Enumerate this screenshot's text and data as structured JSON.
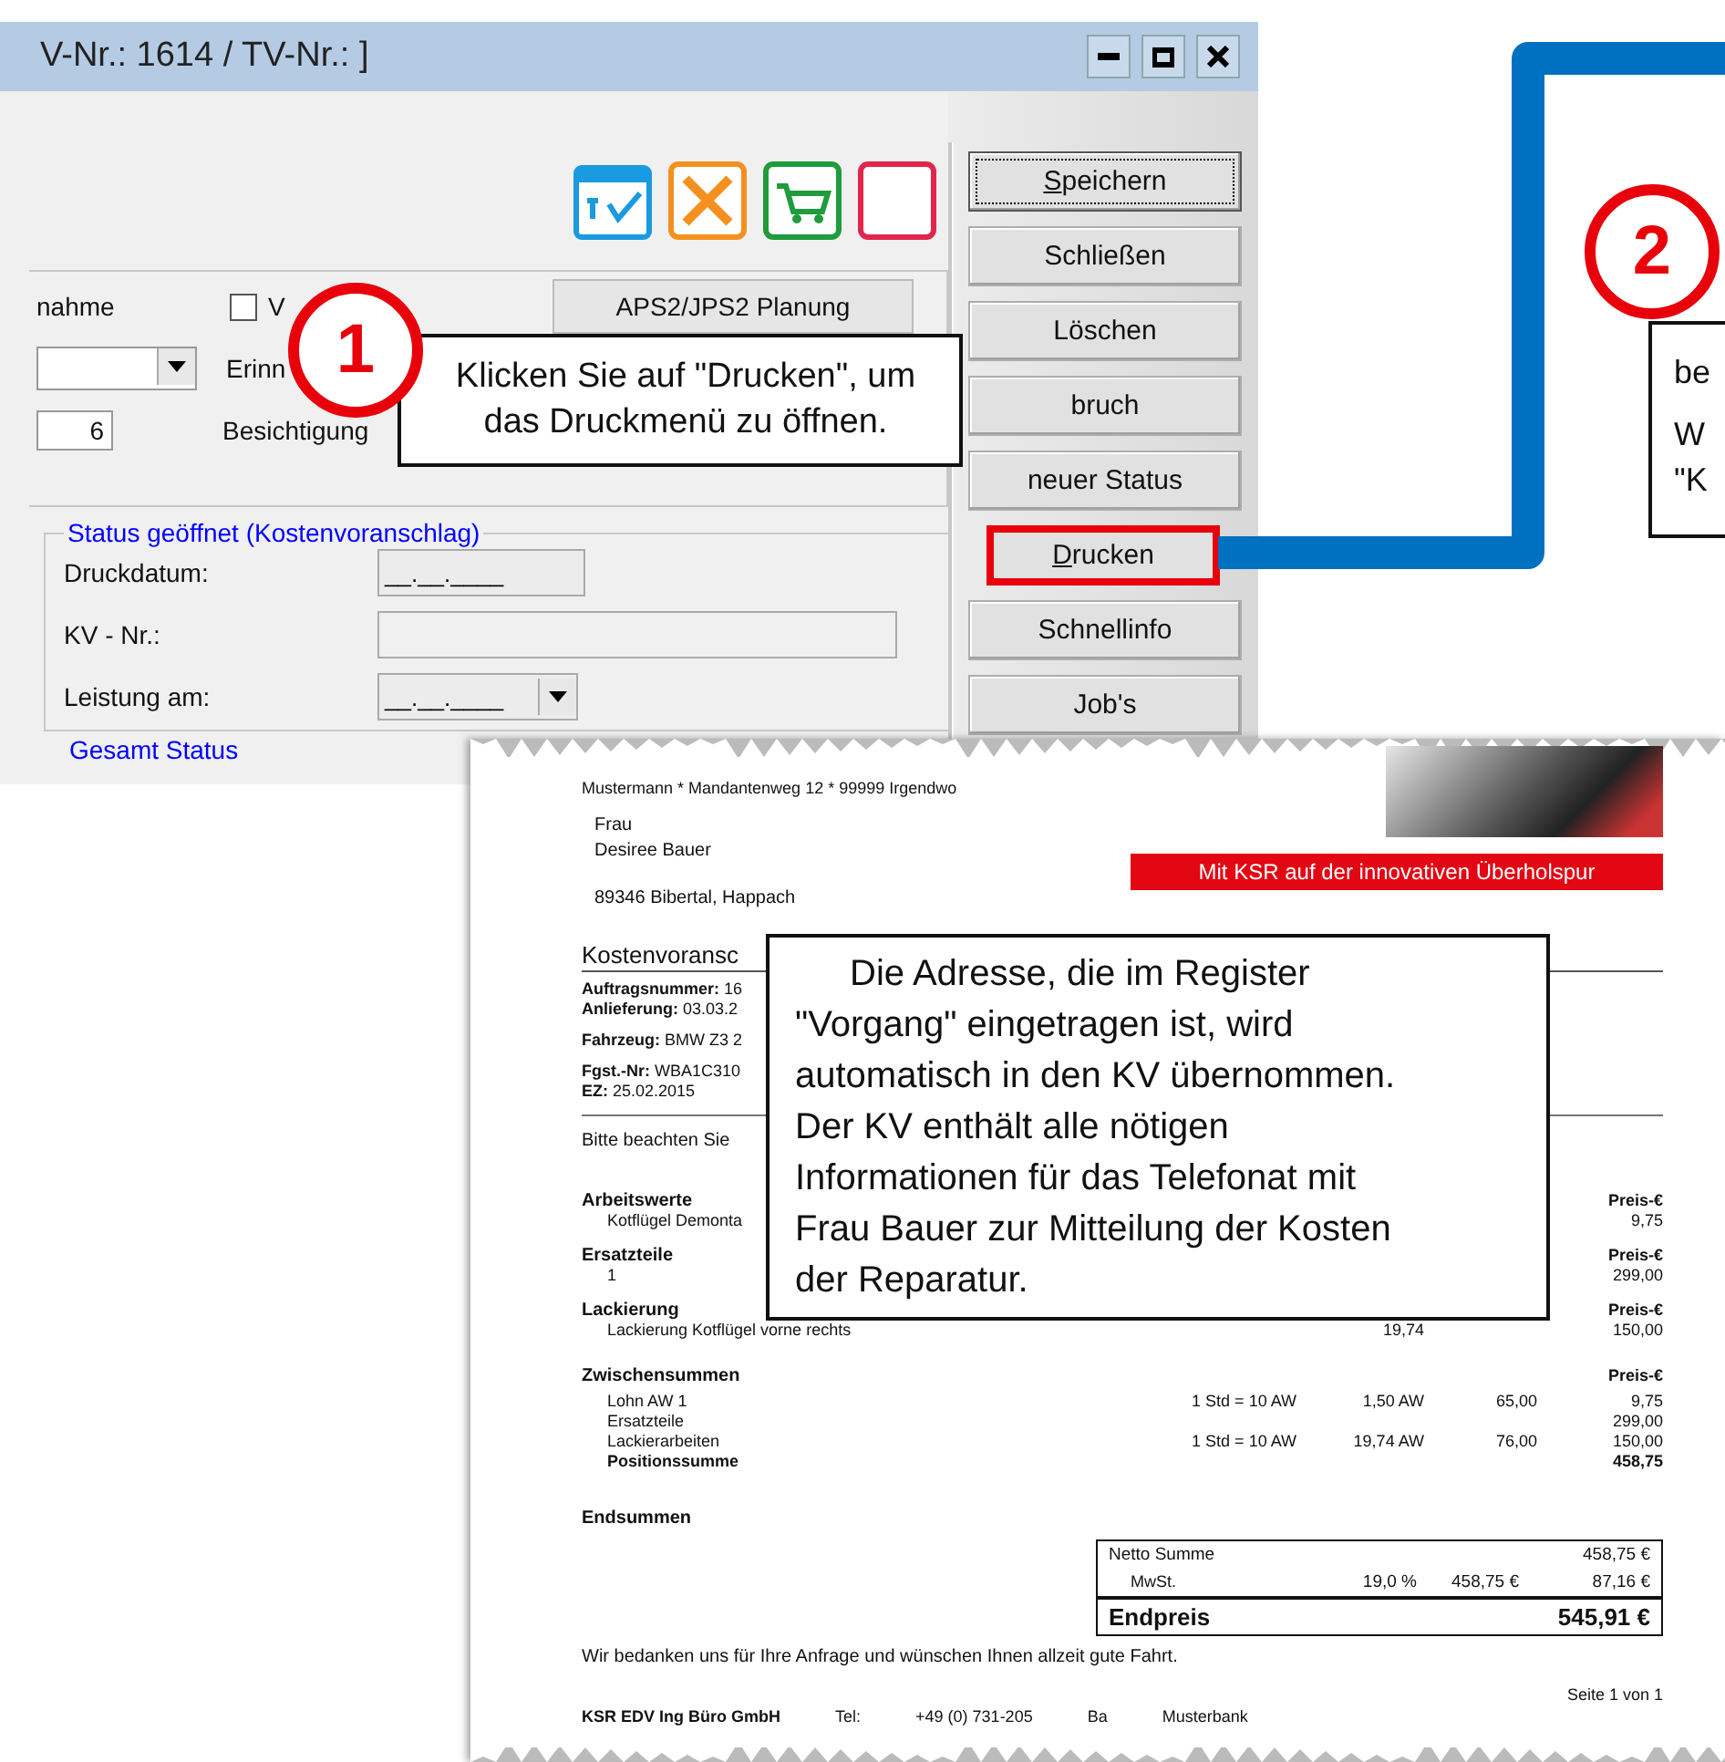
{
  "window": {
    "title": "V-Nr.: 1614 / TV-Nr.:  ]"
  },
  "form": {
    "label_1": "nahme",
    "checkbox": {
      "label": "V",
      "checked": false
    },
    "planning_button": "APS2/JPS2 Planung",
    "label_2": "Erinn",
    "number_field": {
      "value": "6"
    },
    "label_3": "Besichtigung"
  },
  "status_group": {
    "legend": "Status geöffnet (Kostenvoranschlag)",
    "fields": [
      {
        "label": "Druckdatum:",
        "value": "__.__.____",
        "kind": "date"
      },
      {
        "label": "KV - Nr.:",
        "kind": "text"
      },
      {
        "label": "Leistung am:",
        "value": "__.__.____",
        "kind": "dropdown"
      }
    ]
  },
  "total_group": {
    "legend": "Gesamt Status"
  },
  "side_buttons": [
    {
      "label": "Speichern",
      "focused": true,
      "highlighted": false,
      "mnemonic": true
    },
    {
      "label": "Schließen",
      "focused": false,
      "highlighted": false,
      "mnemonic": false
    },
    {
      "label": "Löschen",
      "focused": false,
      "highlighted": false,
      "mnemonic": false
    },
    {
      "label": "bruch",
      "focused": false,
      "highlighted": false,
      "mnemonic": false
    },
    {
      "label": "neuer Status",
      "focused": false,
      "highlighted": false,
      "mnemonic": false
    },
    {
      "label": "Drucken",
      "focused": false,
      "highlighted": true,
      "mnemonic": true
    },
    {
      "label": "Schnellinfo",
      "focused": false,
      "highlighted": false,
      "mnemonic": false
    },
    {
      "label": "Job's",
      "focused": false,
      "highlighted": false,
      "mnemonic": false
    }
  ],
  "callout_1": {
    "number": "1",
    "lines": [
      "Klicken Sie auf \"Drucken\", um",
      "das Druckmenü zu öffnen."
    ]
  },
  "callout_2": {
    "number": "2",
    "lines": [
      "be",
      "W",
      "\"K"
    ]
  },
  "callout_3": {
    "lines": [
      "Die Adresse, die im Register",
      "\"Vorgang\" eingetragen ist, wird",
      "automatisch in den KV übernommen.",
      "Der KV enthält alle nötigen",
      "Informationen für das Telefonat mit",
      "Frau Bauer zur Mitteilung der Kosten",
      "der Reparatur."
    ]
  },
  "document": {
    "sender": "Mustermann * Mandantenweg 12 * 99999 Irgendwo",
    "salutation": "Frau",
    "name": "Desiree Bauer",
    "city": "89346 Bibertal, Happach",
    "banner": "Mit KSR auf der innovativen Überholspur",
    "heading": "Kostenvoransc",
    "details": [
      {
        "label": "Auftragsnummer:",
        "value": "16"
      },
      {
        "label": "Anlieferung:",
        "value": "03.03.2"
      },
      {
        "label": "Fahrzeug:",
        "value": "BMW Z3 2"
      },
      {
        "label": "Fgst.-Nr:",
        "value": "WBA1C310"
      },
      {
        "label": "EZ:",
        "value": "25.02.2015"
      }
    ],
    "note": "Bitte beachten Sie",
    "sections": [
      {
        "title": "Arbeitswerte",
        "price_header": "Preis-€",
        "rows": [
          {
            "text": "Kotflügel Demonta",
            "amount": "9,75"
          }
        ]
      },
      {
        "title": "Ersatzteile",
        "price_header": "Preis-€",
        "rows": [
          {
            "text": "1",
            "amount": "299,00"
          }
        ]
      },
      {
        "title": "Lackierung",
        "price_header": "Preis-€",
        "rows": [
          {
            "text": "Lackierung Kotflügel vorne rechts",
            "units": "19,74",
            "amount": "150,00"
          }
        ]
      }
    ],
    "subtotals": {
      "title": "Zwischensummen",
      "price_header": "Preis-€",
      "rows": [
        {
          "text": "Lohn AW 1",
          "rate": "1 Std = 10 AW",
          "units": "1,50 AW",
          "price": "65,00",
          "amount": "9,75",
          "bold": false
        },
        {
          "text": "Ersatzteile",
          "amount": "299,00",
          "bold": false
        },
        {
          "text": "Lackierarbeiten",
          "rate": "1 Std = 10 AW",
          "units": "19,74 AW",
          "price": "76,00",
          "amount": "150,00",
          "bold": false
        },
        {
          "text": "Positionssumme",
          "amount": "458,75",
          "bold": true
        }
      ]
    },
    "totals_title": "Endsummen",
    "totals": {
      "net": {
        "label": "Netto Summe",
        "amount": "458,75 €"
      },
      "tax": {
        "label": "MwSt.",
        "rate": "19,0 %",
        "base": "458,75 €",
        "amount": "87,16 €"
      },
      "total": {
        "label": "Endpreis",
        "amount": "545,91 €"
      }
    },
    "closing": "Wir bedanken uns für Ihre Anfrage und wünschen Ihnen allzeit gute Fahrt.",
    "page": "Seite 1 von 1",
    "footer": [
      "KSR EDV Ing Büro GmbH",
      "Tel:",
      "+49 (0) 731-205",
      "Ba",
      "Musterbank"
    ]
  }
}
